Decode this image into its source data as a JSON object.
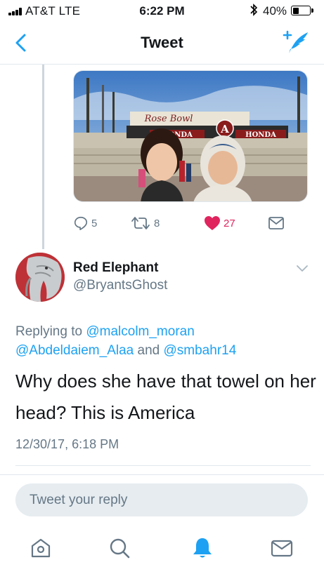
{
  "status_bar": {
    "carrier": "AT&T  LTE",
    "time": "6:22 PM",
    "battery_percent": "40%",
    "battery_level": 0.4,
    "bluetooth_icon": "bluetooth-icon"
  },
  "nav": {
    "title": "Tweet",
    "back_icon": "chevron-left-icon",
    "compose_icon": "compose-tweet-icon"
  },
  "previous_tweet": {
    "media": {
      "sign_script": "Rose Bowl",
      "sign_left": "HONDA",
      "sign_emblem": "A",
      "sign_right": "HONDA"
    },
    "actions": {
      "reply_count": "5",
      "retweet_count": "8",
      "like_count": "27",
      "liked": true
    }
  },
  "tweet": {
    "author_name": "Red Elephant",
    "author_handle": "@BryantsGhost",
    "replying_label": "Replying to",
    "mentions": [
      "@malcolm_moran",
      "@Abdeldaiem_Alaa",
      "@smbahr14"
    ],
    "mention_joiner": "and",
    "text": "Why does she have that towel on her head? This is America",
    "timestamp": "12/30/17, 6:18 PM"
  },
  "reply_box": {
    "placeholder": "Tweet your reply"
  },
  "tab_bar": {
    "tabs": [
      "home-icon",
      "search-icon",
      "notifications-icon",
      "messages-icon"
    ],
    "active": "notifications-icon"
  },
  "colors": {
    "accent": "#1da1f2",
    "like": "#e0245e",
    "secondary_text": "#657786",
    "divider": "#e1e8ed",
    "reply_bg": "#e6ecf0"
  }
}
